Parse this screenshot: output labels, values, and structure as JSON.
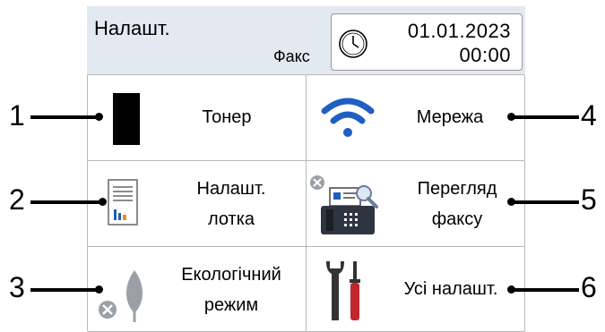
{
  "header": {
    "title": "Налашт.",
    "mode": "Факс",
    "date": "01.01.2023",
    "time": "00:00"
  },
  "tiles": [
    {
      "label": "Тонер",
      "icon": "toner-cartridge-icon"
    },
    {
      "label": "Мережа",
      "icon": "wifi-icon"
    },
    {
      "label_line1": "Налашт.",
      "label_line2": "лотка",
      "icon": "tray-settings-icon"
    },
    {
      "label_line1": "Перегляд",
      "label_line2": "факсу",
      "icon": "fax-preview-icon"
    },
    {
      "label_line1": "Екологічний",
      "label_line2": "режим",
      "icon": "eco-mode-icon"
    },
    {
      "label": "Усі налашт.",
      "icon": "tools-icon"
    }
  ],
  "callouts": [
    "1",
    "2",
    "3",
    "4",
    "5",
    "6"
  ],
  "colors": {
    "header_bg": "#e3e9f0",
    "wifi_blue": "#1f5fbf",
    "eco_gray": "#9aa0a6",
    "tools_red": "#c0282d",
    "tools_dark": "#333333"
  }
}
